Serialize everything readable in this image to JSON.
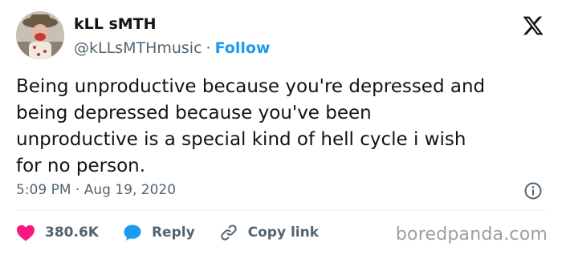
{
  "author": {
    "display_name": "kLL sMTH",
    "handle": "@kLLsMTHmusic",
    "separator": "·",
    "follow_label": "Follow",
    "avatar_icon": "profile-photo"
  },
  "platform_icon": "x-logo-icon",
  "tweet": {
    "text": "Being unproductive because you're depressed and\nbeing depressed because you've been\nunproductive is a special kind of hell cycle i wish\nfor no person.",
    "time": "5:09 PM",
    "date_separator": "·",
    "date": "Aug 19, 2020"
  },
  "actions": {
    "likes": "380.6K",
    "reply_label": "Reply",
    "copy_label": "Copy link"
  },
  "colors": {
    "like": "#f91880",
    "accent": "#1d9bf0",
    "muted": "#536471",
    "text": "#0f1419"
  },
  "watermark": "boredpanda.com"
}
